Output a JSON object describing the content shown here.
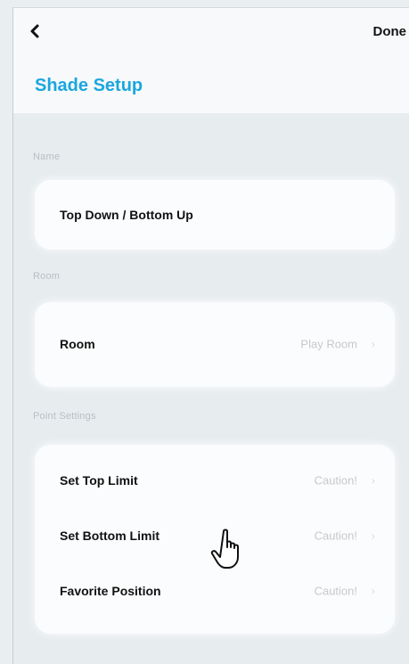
{
  "header": {
    "back_icon": "chevron-left-icon",
    "done_label": "Done",
    "title": "Shade Setup"
  },
  "sections": {
    "name": {
      "label": "Name",
      "value": "Top Down / Bottom Up"
    },
    "room": {
      "label": "Room",
      "row_label": "Room",
      "row_value": "Play Room"
    },
    "point_settings": {
      "label": "Point Settings",
      "rows": [
        {
          "label": "Set Top Limit",
          "value": "Caution!"
        },
        {
          "label": "Set Bottom Limit",
          "value": "Caution!"
        },
        {
          "label": "Favorite Position",
          "value": "Caution!"
        }
      ]
    }
  },
  "colors": {
    "accent": "#1aa7df",
    "background": "#e9eef1"
  },
  "cursor_icon": "hand-pointer-icon"
}
